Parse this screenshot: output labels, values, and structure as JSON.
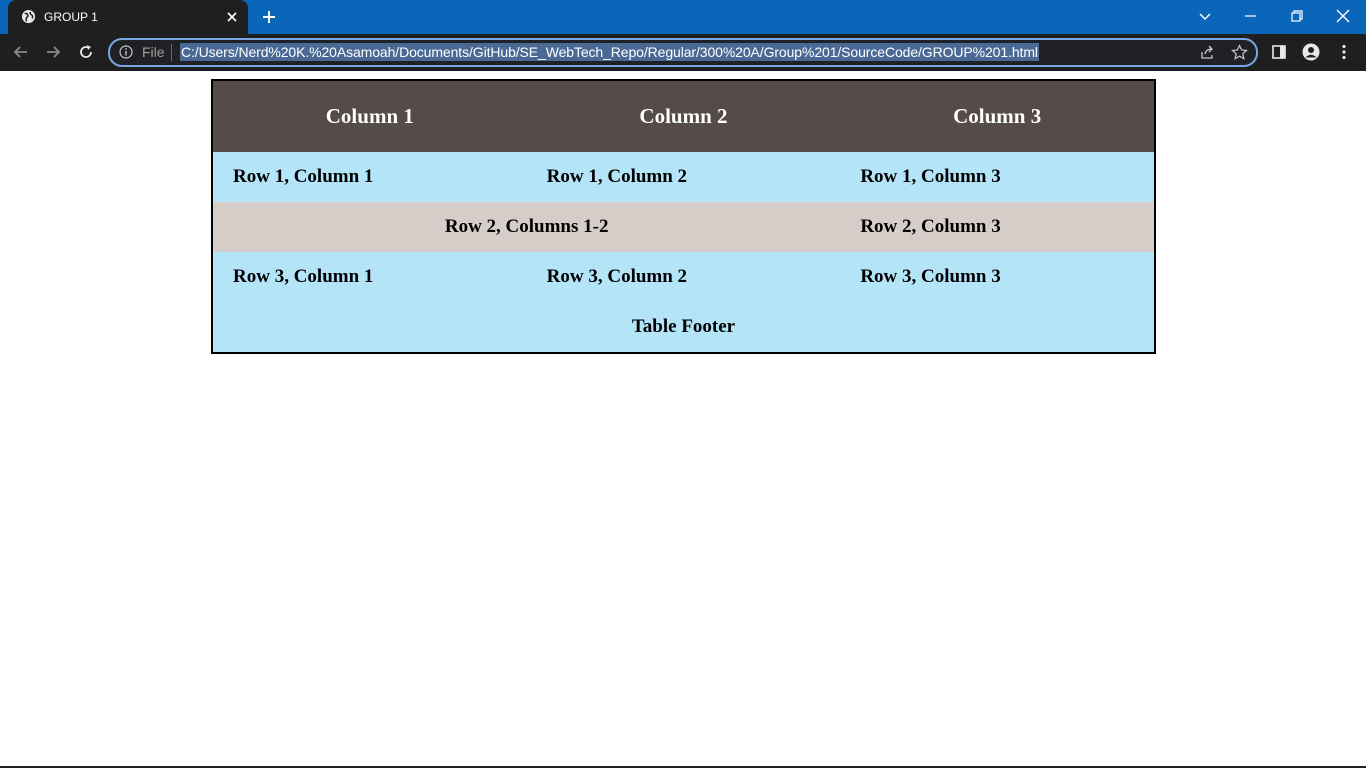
{
  "browser": {
    "tab_title": "GROUP 1",
    "address_scheme": "File",
    "url": "C:/Users/Nerd%20K.%20Asamoah/Documents/GitHub/SE_WebTech_Repo/Regular/300%20A/Group%201/SourceCode/GROUP%201.html",
    "accent_color": "#0a66b8"
  },
  "page": {
    "table": {
      "headers": [
        "Column 1",
        "Column 2",
        "Column 3"
      ],
      "rows": [
        [
          "Row 1, Column 1",
          "Row 1, Column 2",
          "Row 1, Column 3"
        ],
        [
          "Row 2, Columns 1-2",
          "Row 2, Column 3"
        ],
        [
          "Row 3, Column 1",
          "Row 3, Column 2",
          "Row 3, Column 3"
        ]
      ],
      "footer": "Table Footer",
      "header_color": "#554c4a",
      "row_color_blue": "#b3e4f8",
      "row_color_tan": "#d6cdc8"
    }
  }
}
